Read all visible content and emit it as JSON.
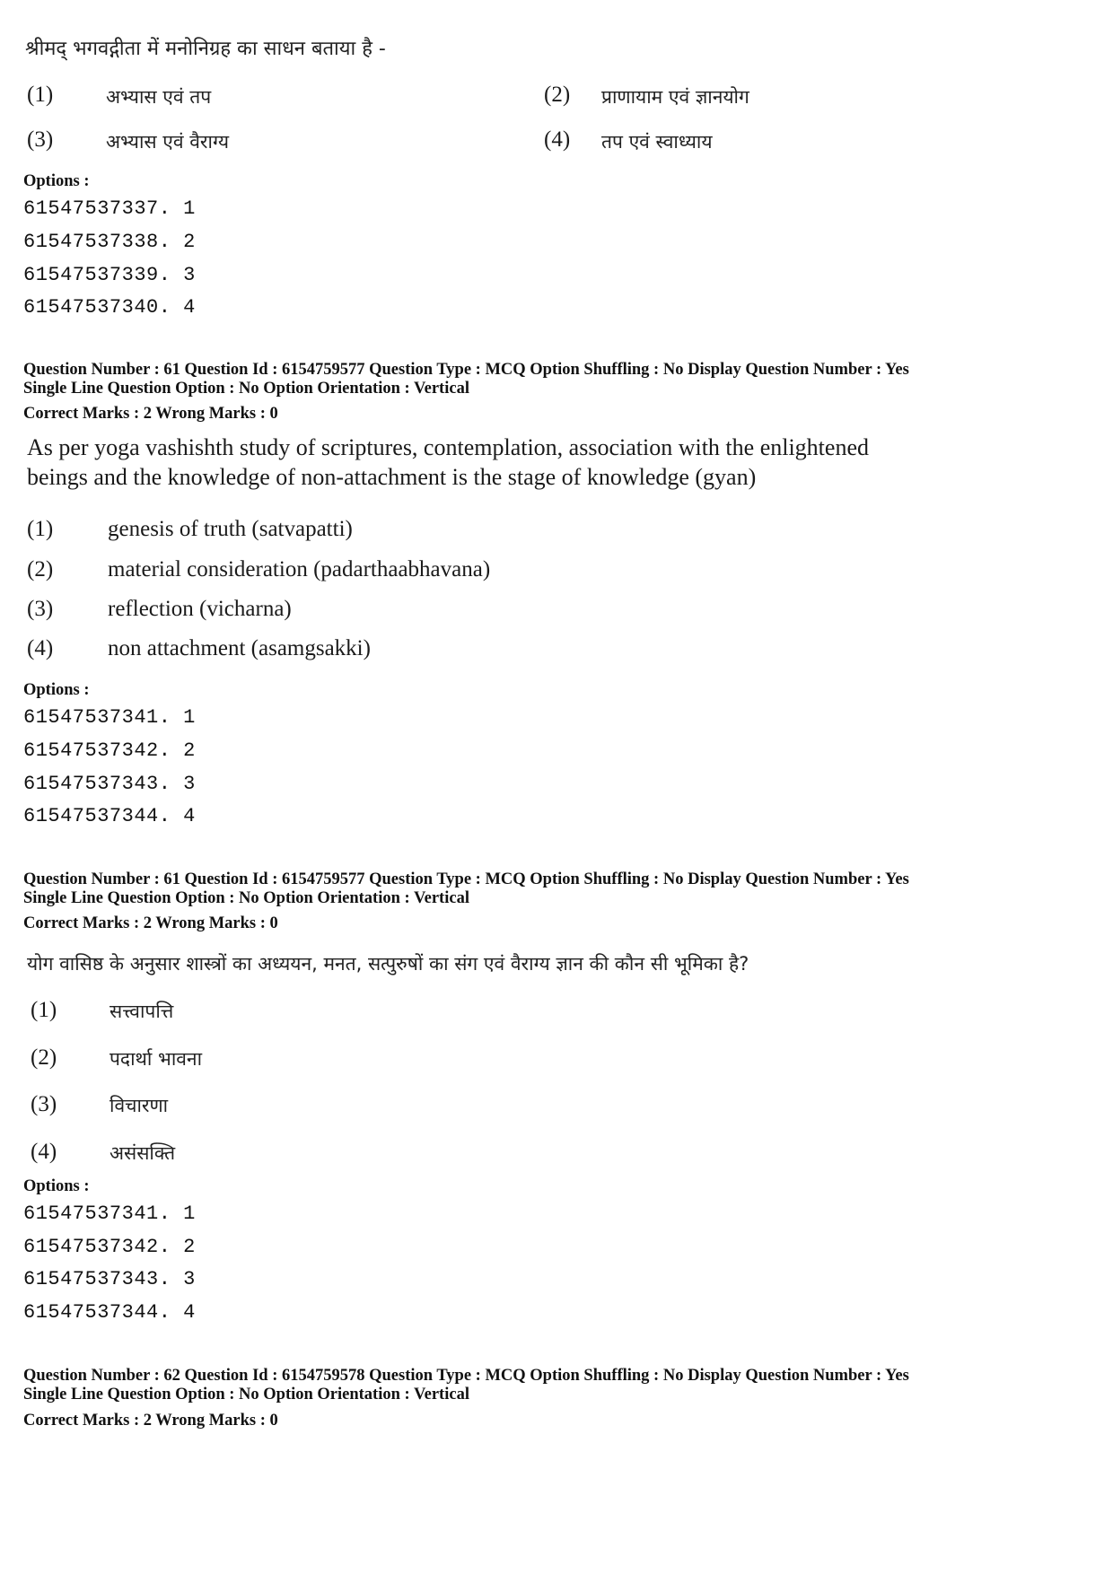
{
  "block1": {
    "question_text": "श्रीमद् भगवद्गीता में मनोनिग्रह का साधन बताया है -",
    "options": [
      {
        "num": "(1)",
        "text": "अभ्यास एवं तप"
      },
      {
        "num": "(2)",
        "text": "प्राणायाम एवं ज्ञानयोग"
      },
      {
        "num": "(3)",
        "text": "अभ्यास एवं वैराग्य"
      },
      {
        "num": "(4)",
        "text": "तप एवं स्वाध्याय"
      }
    ],
    "options_label": "Options :",
    "option_ids": [
      "61547537337. 1",
      "61547537338. 2",
      "61547537339. 3",
      "61547537340. 4"
    ]
  },
  "block2": {
    "meta_line1": "Question Number : 61  Question Id : 6154759577  Question Type : MCQ  Option Shuffling : No  Display Question Number : Yes",
    "meta_line2": "Single Line Question Option : No  Option Orientation : Vertical",
    "marks_line": "Correct Marks : 2  Wrong Marks : 0",
    "question_line1": "As per yoga vashishth study of scriptures, contemplation, association with the enlightened",
    "question_line2": "beings and the knowledge of non-attachment is the stage of knowledge (gyan)",
    "options": [
      {
        "num": "(1)",
        "text": "genesis of truth (satvapatti)"
      },
      {
        "num": "(2)",
        "text": "material consideration (padarthaabhavana)"
      },
      {
        "num": "(3)",
        "text": "reflection (vicharna)"
      },
      {
        "num": "(4)",
        "text": "non attachment (asamgsakki)"
      }
    ],
    "options_label": "Options :",
    "option_ids": [
      "61547537341. 1",
      "61547537342. 2",
      "61547537343. 3",
      "61547537344. 4"
    ]
  },
  "block3": {
    "meta_line1": "Question Number : 61  Question Id : 6154759577  Question Type : MCQ  Option Shuffling : No  Display Question Number : Yes",
    "meta_line2": "Single Line Question Option : No  Option Orientation : Vertical",
    "marks_line": "Correct Marks : 2  Wrong Marks : 0",
    "question_text": "योग वासिष्ठ के अनुसार शास्त्रों का अध्ययन, मनत, सत्पुरुषों का संग एवं वैराग्य ज्ञान की कौन सी भूमिका है?",
    "options": [
      {
        "num": "(1)",
        "text": "सत्त्वापत्ति"
      },
      {
        "num": "(2)",
        "text": "पदार्था भावना"
      },
      {
        "num": "(3)",
        "text": "विचारणा"
      },
      {
        "num": "(4)",
        "text": "असंसक्ति"
      }
    ],
    "options_label": "Options :",
    "option_ids": [
      "61547537341. 1",
      "61547537342. 2",
      "61547537343. 3",
      "61547537344. 4"
    ]
  },
  "block4": {
    "meta_line1": "Question Number : 62  Question Id : 6154759578  Question Type : MCQ  Option Shuffling : No  Display Question Number : Yes",
    "meta_line2": "Single Line Question Option : No  Option Orientation : Vertical",
    "marks_line": "Correct Marks : 2  Wrong Marks : 0"
  }
}
